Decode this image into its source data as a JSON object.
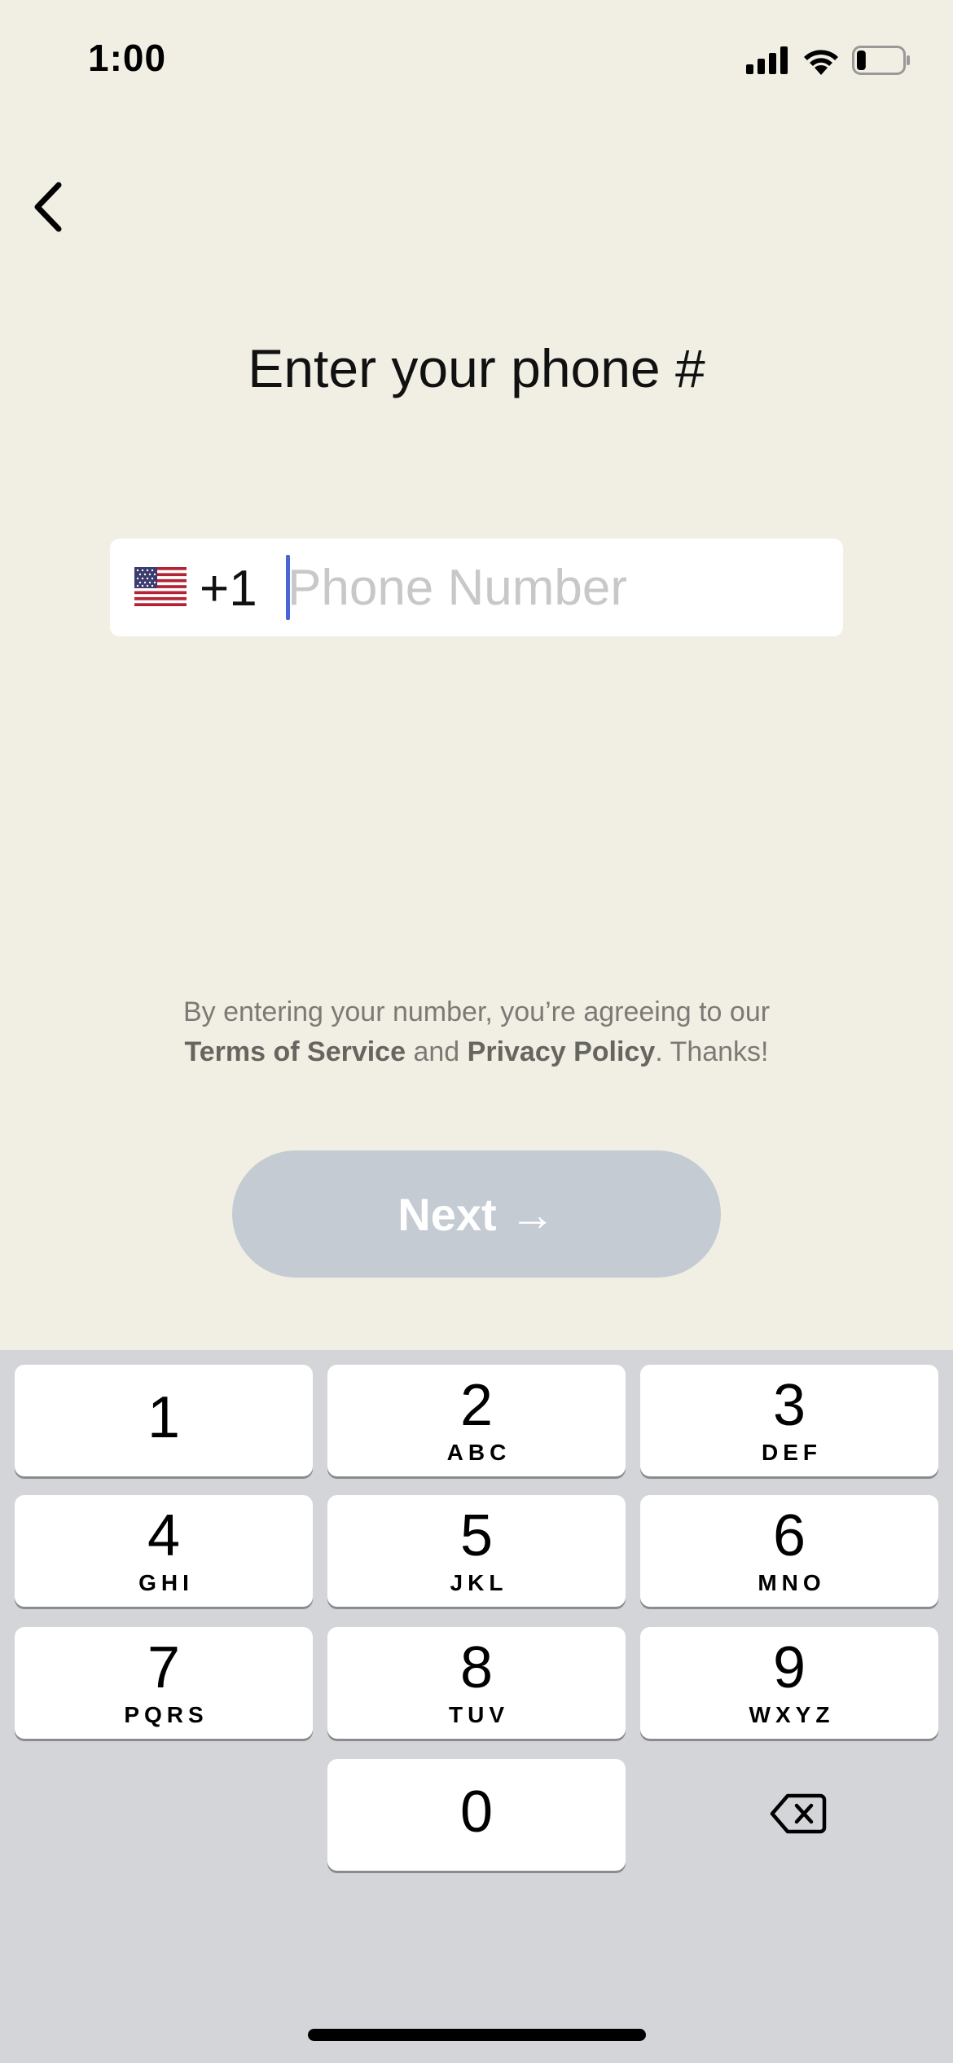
{
  "status_bar": {
    "time": "1:00",
    "icons": [
      "cellular-signal-icon",
      "wifi-icon",
      "battery-icon"
    ],
    "battery_level": 0.2
  },
  "nav": {
    "back_icon": "chevron-left-icon"
  },
  "title": "Enter your phone #",
  "phone": {
    "flag": "us-flag-icon",
    "country_code": "+1",
    "placeholder": "Phone Number",
    "value": ""
  },
  "legal": {
    "prefix": "By entering your number, you’re agreeing to our",
    "terms": "Terms of Service",
    "and": "and",
    "privacy": "Privacy Policy",
    "suffix": ". Thanks!"
  },
  "next_button": {
    "label": "Next",
    "arrow": "→"
  },
  "keyboard": {
    "keys": [
      {
        "digit": "1",
        "letters": ""
      },
      {
        "digit": "2",
        "letters": "ABC"
      },
      {
        "digit": "3",
        "letters": "DEF"
      },
      {
        "digit": "4",
        "letters": "GHI"
      },
      {
        "digit": "5",
        "letters": "JKL"
      },
      {
        "digit": "6",
        "letters": "MNO"
      },
      {
        "digit": "7",
        "letters": "PQRS"
      },
      {
        "digit": "8",
        "letters": "TUV"
      },
      {
        "digit": "9",
        "letters": "WXYZ"
      },
      {
        "digit": "0",
        "letters": ""
      }
    ],
    "delete_icon": "backspace-icon"
  },
  "colors": {
    "background": "#f1efe4",
    "caret": "#4a63d9",
    "next_disabled": "#c4cbd3",
    "keyboard": "#d4d5d9"
  }
}
